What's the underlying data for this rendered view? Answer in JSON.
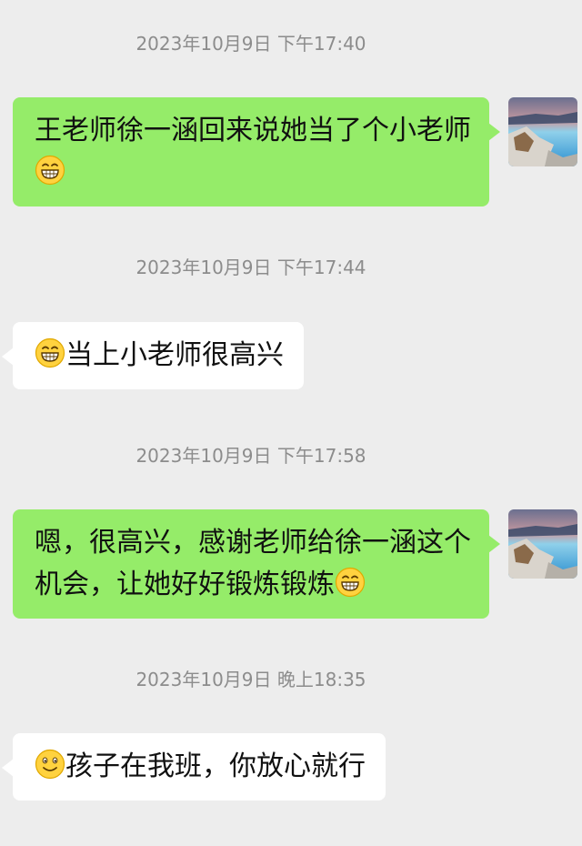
{
  "chat": {
    "messages": [
      {
        "timestamp": "2023年10月9日 下午17:40",
        "direction": "sent",
        "text": "王老师徐一涵回来说她当了个小老师",
        "trailing_emoji": "grin-emoji"
      },
      {
        "timestamp": "2023年10月9日 下午17:44",
        "direction": "received",
        "leading_emoji": "grin-emoji",
        "text": "当上小老师很高兴"
      },
      {
        "timestamp": "2023年10月9日 下午17:58",
        "direction": "sent",
        "text": "嗯，很高兴，感谢老师给徐一涵这个机会，让她好好锻炼锻炼",
        "trailing_emoji": "grin-emoji"
      },
      {
        "timestamp": "2023年10月9日 晚上18:35",
        "direction": "received",
        "leading_emoji": "smile-emoji",
        "text": "孩子在我班，你放心就行"
      }
    ]
  },
  "colors": {
    "background": "#ededed",
    "sent_bubble": "#95ec69",
    "received_bubble": "#ffffff",
    "timestamp_text": "#8c8c8c"
  }
}
